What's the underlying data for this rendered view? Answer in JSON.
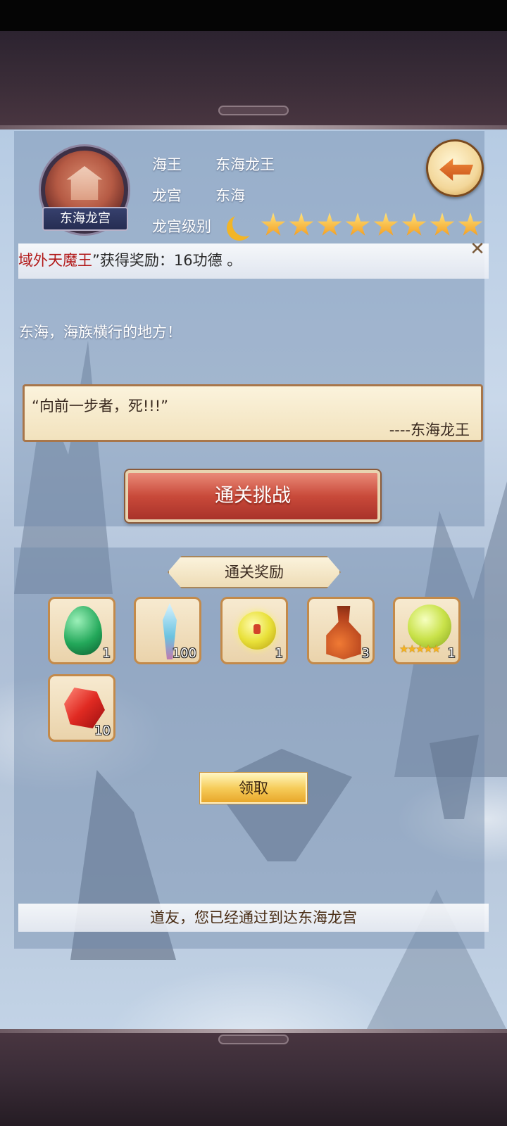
{
  "header": {
    "emblem_label": "东海龙宫",
    "rows": [
      {
        "label": "海王",
        "value": "东海龙王"
      },
      {
        "label": "龙宫",
        "value": "东海"
      },
      {
        "label": "龙宫级别",
        "value": ""
      }
    ],
    "star_rating": 8,
    "back_icon": "back-arrow-icon"
  },
  "marquee": {
    "name_part": "域外天魔王",
    "rest": "”获得奖励：16功德 。",
    "close_icon": "close-icon"
  },
  "description": "东海，海族横行的地方！",
  "quote": {
    "text": "“向前一步者，死!!!”",
    "author": "----东海龙王"
  },
  "challenge_button": "通关挑战",
  "rewards": {
    "title": "通关奖励",
    "items": [
      {
        "icon": "green-egg-icon",
        "count": "1"
      },
      {
        "icon": "crystal-sword-icon",
        "count": "100"
      },
      {
        "icon": "yellow-orb-icon",
        "count": "1"
      },
      {
        "icon": "gourd-icon",
        "count": "3"
      },
      {
        "icon": "spirit-sphere-icon",
        "count": "1"
      },
      {
        "icon": "red-gem-icon",
        "count": "10"
      }
    ]
  },
  "claim_button": "领取",
  "status": "道友，您已经通过到达东海龙宫",
  "colors": {
    "accent_red": "#c94a3a",
    "star_gold": "#f29a1c",
    "marquee_name": "#b21a1a"
  }
}
